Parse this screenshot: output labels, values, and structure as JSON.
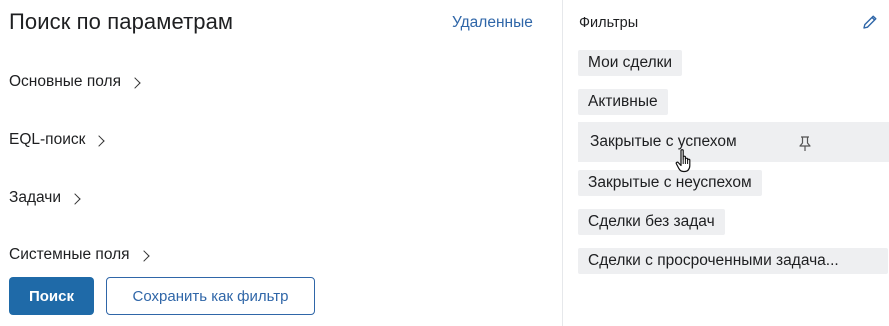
{
  "search": {
    "title": "Поиск по параметрам",
    "deleted_link": "Удаленные",
    "sections": [
      "Основные поля",
      "EQL-поиск",
      "Задачи",
      "Системные поля"
    ],
    "search_button": "Поиск",
    "save_filter_button": "Сохранить как фильтр"
  },
  "filters": {
    "title": "Фильтры",
    "items": [
      "Мои сделки",
      "Активные",
      "Закрытые с успехом",
      "Закрытые с неуспехом",
      "Сделки без задач",
      "Сделки с просроченными задача..."
    ]
  },
  "colors": {
    "accent": "#1f6aa8",
    "link": "#2f66a8",
    "chip_bg": "#eeeff1"
  },
  "icons": {
    "edit": "pencil-icon",
    "pin": "pin-icon",
    "chevron": "chevron-right-icon",
    "cursor": "hand-pointer-icon"
  }
}
